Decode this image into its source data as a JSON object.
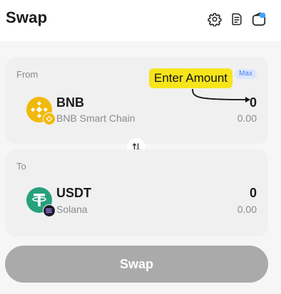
{
  "header": {
    "title": "Swap",
    "icons": [
      "gear-icon",
      "history-icon",
      "wallet-icon"
    ]
  },
  "from": {
    "label": "From",
    "max_label": "Max",
    "token": {
      "symbol": "BNB",
      "chain": "BNB Smart Chain",
      "amount": "0",
      "fiat_value": "0.00",
      "logo_color": "#f0b90b"
    },
    "annotation": "Enter Amount"
  },
  "to": {
    "label": "To",
    "token": {
      "symbol": "USDT",
      "chain": "Solana",
      "amount": "0",
      "fiat_value": "0.00",
      "logo_color": "#26a17b"
    }
  },
  "swap_button": {
    "label": "Swap",
    "state": "disabled",
    "color": "#aaaaaa"
  },
  "colors": {
    "annotation_bg": "#f6e51a",
    "max_bg": "#dbe7fd",
    "max_text": "#4a7ff0"
  }
}
